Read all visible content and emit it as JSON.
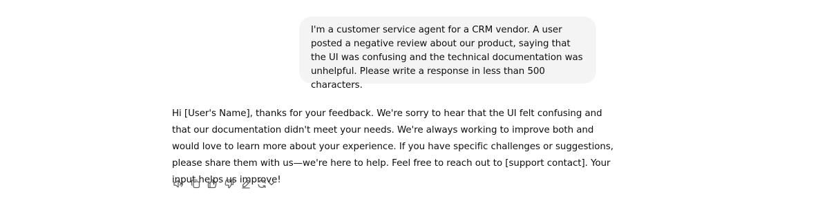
{
  "user_message": {
    "text": "I'm a customer service agent for a CRM vendor. A user posted a negative review about our product, saying that the UI was confusing and the technical documentation was unhelpful. Please write a response in less than 500 characters."
  },
  "assistant_message": {
    "text": "Hi [User's Name], thanks for your feedback. We're sorry to hear that the UI felt confusing and that our documentation didn't meet your needs. We're always working to improve both and would love to learn more about your experience. If you have specific challenges or suggestions, please share them with us—we're here to help. Feel free to reach out to [support contact]. Your input helps us improve!"
  },
  "actions": [
    {
      "icon": "speaker-icon"
    },
    {
      "icon": "copy-icon"
    },
    {
      "icon": "thumbs-up-icon"
    },
    {
      "icon": "thumbs-down-icon"
    },
    {
      "icon": "edit-pen-icon"
    },
    {
      "icon": "regenerate-icon"
    }
  ]
}
